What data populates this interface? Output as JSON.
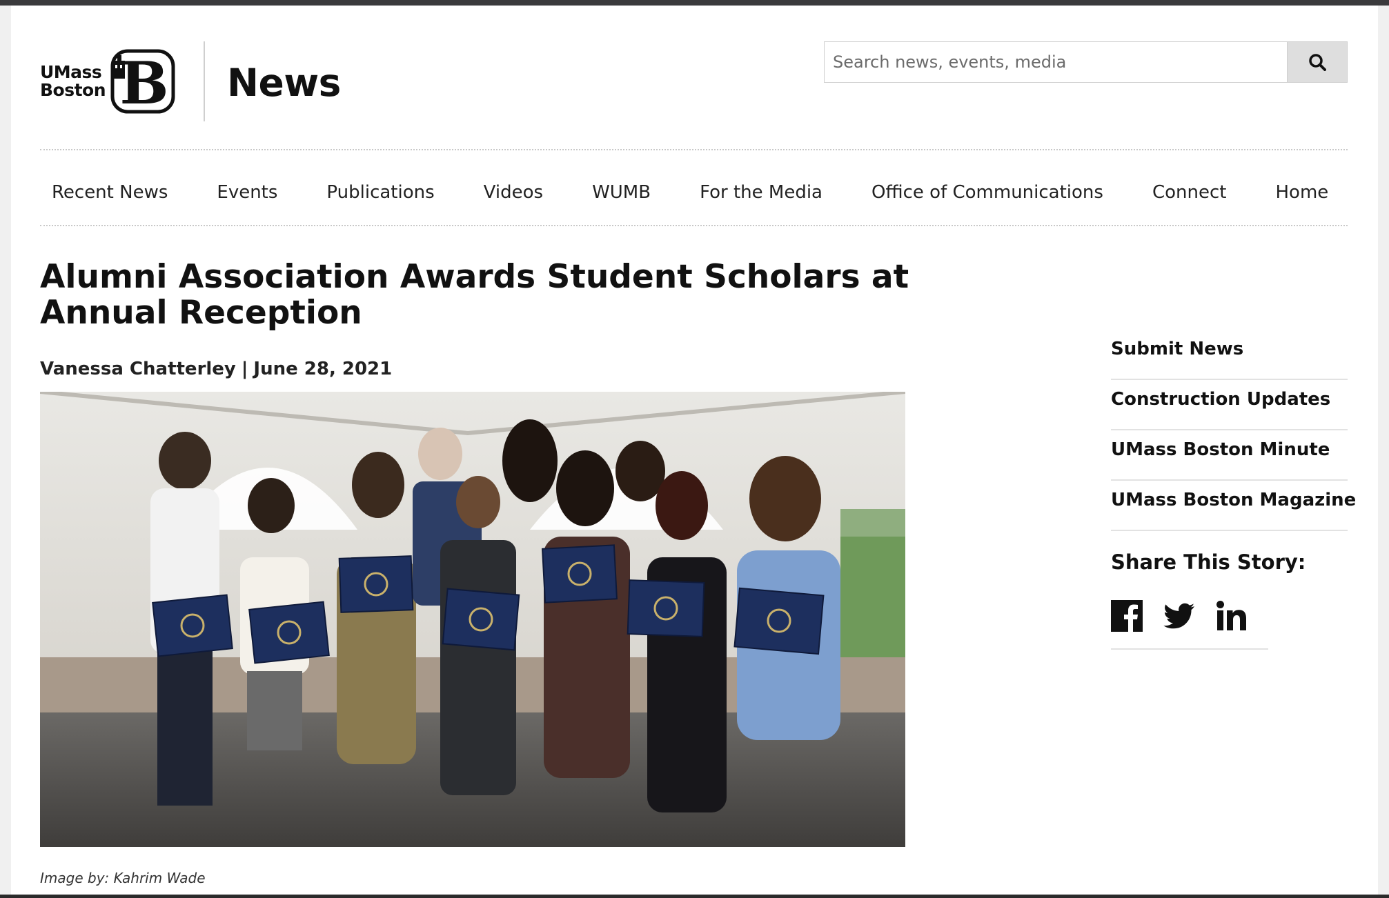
{
  "header": {
    "logo_line1": "UMass",
    "logo_line2": "Boston",
    "site_name": "News",
    "search": {
      "placeholder": "Search news, events, media"
    }
  },
  "icons": {
    "logo": "umass-boston-b-logo",
    "search": "magnifier-icon",
    "facebook": "facebook-icon",
    "twitter": "twitter-icon",
    "linkedin": "linkedin-icon"
  },
  "nav": {
    "items": [
      {
        "label": "Recent News"
      },
      {
        "label": "Events"
      },
      {
        "label": "Publications"
      },
      {
        "label": "Videos"
      },
      {
        "label": "WUMB"
      },
      {
        "label": "For the Media"
      },
      {
        "label": "Office of Communications"
      },
      {
        "label": "Connect"
      },
      {
        "label": "Home"
      }
    ]
  },
  "article": {
    "title": "Alumni Association Awards Student Scholars at Annual Reception",
    "author": "Vanessa Chatterley",
    "separator": "|",
    "date": "June 28, 2021",
    "photo_alt": "Alumni Association scholarship recipients holding certificates under a tent",
    "caption": "Image by: Kahrim Wade"
  },
  "sidebar": {
    "links": [
      {
        "label": "Submit News"
      },
      {
        "label": "Construction Updates"
      },
      {
        "label": "UMass Boston Minute"
      },
      {
        "label": "UMass Boston Magazine"
      }
    ],
    "share_title": "Share This Story:"
  },
  "colors": {
    "text": "#111111",
    "divider": "#c8c8c8",
    "search_button": "#dedede"
  }
}
